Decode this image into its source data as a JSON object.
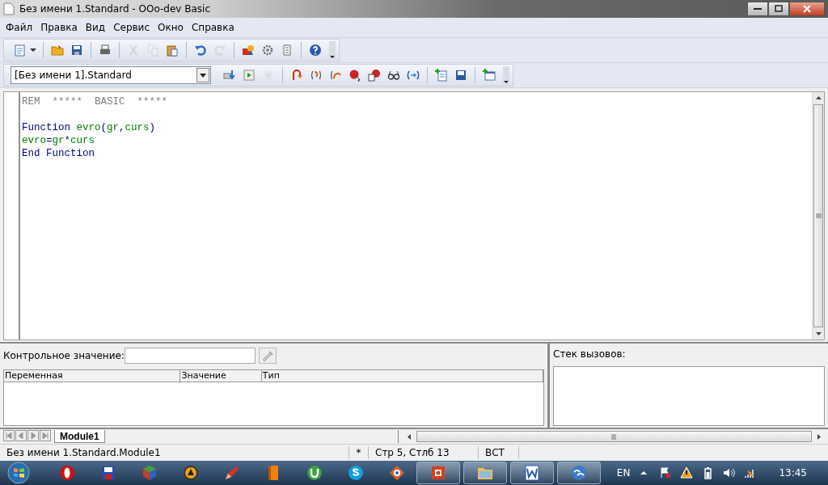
{
  "window": {
    "title": "Без имени 1.Standard - OOo-dev Basic"
  },
  "menu": [
    {
      "label": "Файл"
    },
    {
      "label": "Правка"
    },
    {
      "label": "Вид"
    },
    {
      "label": "Сервис"
    },
    {
      "label": "Окно"
    },
    {
      "label": "Справка"
    }
  ],
  "standard_toolbar": [
    {
      "kind": "new",
      "disabled": false
    },
    {
      "kind": "dropdown",
      "disabled": false
    },
    {
      "kind": "sep"
    },
    {
      "kind": "open",
      "disabled": false
    },
    {
      "kind": "save",
      "disabled": false
    },
    {
      "kind": "sep"
    },
    {
      "kind": "print",
      "disabled": false
    },
    {
      "kind": "sep"
    },
    {
      "kind": "cut",
      "disabled": true
    },
    {
      "kind": "copy",
      "disabled": true
    },
    {
      "kind": "paste",
      "disabled": false
    },
    {
      "kind": "sep"
    },
    {
      "kind": "undo",
      "disabled": false
    },
    {
      "kind": "redo",
      "disabled": true
    },
    {
      "kind": "sep"
    },
    {
      "kind": "shapes",
      "disabled": false
    },
    {
      "kind": "gear",
      "disabled": false
    },
    {
      "kind": "scroll",
      "disabled": false
    },
    {
      "kind": "sep"
    },
    {
      "kind": "help",
      "disabled": false
    }
  ],
  "macro_toolbar": {
    "library": "[Без имени 1].Standard",
    "buttons": [
      {
        "kind": "compile",
        "disabled": false
      },
      {
        "kind": "run",
        "disabled": false
      },
      {
        "kind": "stop",
        "disabled": true
      },
      {
        "kind": "sep"
      },
      {
        "kind": "stepover",
        "disabled": false
      },
      {
        "kind": "stepin",
        "disabled": false
      },
      {
        "kind": "stepout",
        "disabled": false
      },
      {
        "kind": "breakpoint",
        "disabled": false
      },
      {
        "kind": "manage",
        "disabled": false
      },
      {
        "kind": "watch",
        "disabled": false
      },
      {
        "kind": "bracket",
        "disabled": false
      },
      {
        "kind": "sep"
      },
      {
        "kind": "insert",
        "disabled": false
      },
      {
        "kind": "savefile",
        "disabled": false
      },
      {
        "kind": "sep"
      },
      {
        "kind": "dialog",
        "disabled": false
      }
    ]
  },
  "editor": {
    "lines": [
      {
        "blank_before": false,
        "tokens": [
          {
            "text": "REM  *****  BASIC  *****",
            "kind": "comment"
          }
        ]
      },
      {
        "blank_before": true,
        "tokens": [
          {
            "text": "Function",
            "kind": "keyword"
          },
          {
            "text": "evro",
            "kind": "identifier",
            "space_before": true
          },
          {
            "text": "(",
            "kind": "operator"
          },
          {
            "text": "gr",
            "kind": "identifier"
          },
          {
            "text": ",",
            "kind": "operator"
          },
          {
            "text": "curs",
            "kind": "identifier"
          },
          {
            "text": ")",
            "kind": "operator"
          }
        ]
      },
      {
        "blank_before": false,
        "tokens": [
          {
            "text": "evro",
            "kind": "identifier"
          },
          {
            "text": "=",
            "kind": "operator"
          },
          {
            "text": "gr",
            "kind": "identifier"
          },
          {
            "text": "*",
            "kind": "operator"
          },
          {
            "text": "curs",
            "kind": "identifier"
          }
        ]
      },
      {
        "blank_before": false,
        "tokens": [
          {
            "text": "End",
            "kind": "keyword"
          },
          {
            "text": "Function",
            "kind": "keyword",
            "space_before": true
          }
        ]
      }
    ]
  },
  "watch": {
    "label": "Контрольное значение:",
    "columns": [
      "Переменная",
      "Значение",
      "Тип"
    ]
  },
  "call_stack": {
    "label": "Стек вызовов:"
  },
  "module_tabs": [
    {
      "label": "Module1",
      "selected": true
    }
  ],
  "status_bar": [
    {
      "text": "Без имени 1.Standard.Module1"
    },
    {
      "text": "*"
    },
    {
      "text": "Стр 5, Стлб 13"
    },
    {
      "text": "ВСТ"
    }
  ],
  "taskbar": {
    "apps": [
      {
        "kind": "opera",
        "open": false
      },
      {
        "kind": "floppy",
        "open": false
      },
      {
        "kind": "cube",
        "open": false
      },
      {
        "kind": "aimp",
        "open": false
      },
      {
        "kind": "pencil",
        "open": false
      },
      {
        "kind": "book",
        "open": false
      },
      {
        "kind": "torrent",
        "open": false
      },
      {
        "kind": "skype",
        "open": false
      },
      {
        "kind": "eye",
        "open": false
      },
      {
        "kind": "impress",
        "open": true
      },
      {
        "kind": "folder",
        "open": true
      },
      {
        "kind": "word",
        "open": true
      },
      {
        "kind": "ooo",
        "open": true
      }
    ],
    "language": "EN",
    "clock": "13:45"
  }
}
